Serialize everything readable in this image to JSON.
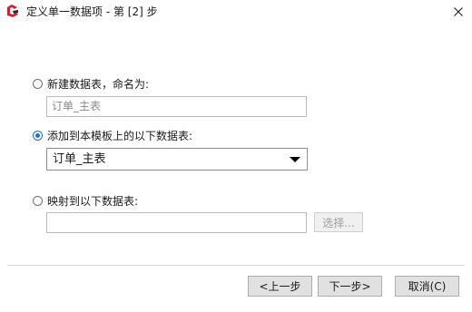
{
  "window": {
    "title": "定义单一数据项 - 第 [2] 步",
    "close_glyph": "✕"
  },
  "options": {
    "new_table": {
      "label": "新建数据表，命名为:",
      "input_value": "",
      "input_placeholder": "订单_主表",
      "checked": false
    },
    "add_to_template": {
      "label": "添加到本模板上的以下数据表:",
      "selected_value": "订单_主表",
      "checked": true
    },
    "map_to_table": {
      "label": "映射到以下数据表:",
      "input_value": "",
      "select_button_label": "选择...",
      "checked": false
    }
  },
  "footer": {
    "prev_label": "<上一步",
    "next_label": "下一步>",
    "cancel_label": "取消(C)"
  },
  "colors": {
    "accent": "#1e6fd0",
    "icon_red": "#d4202c"
  }
}
